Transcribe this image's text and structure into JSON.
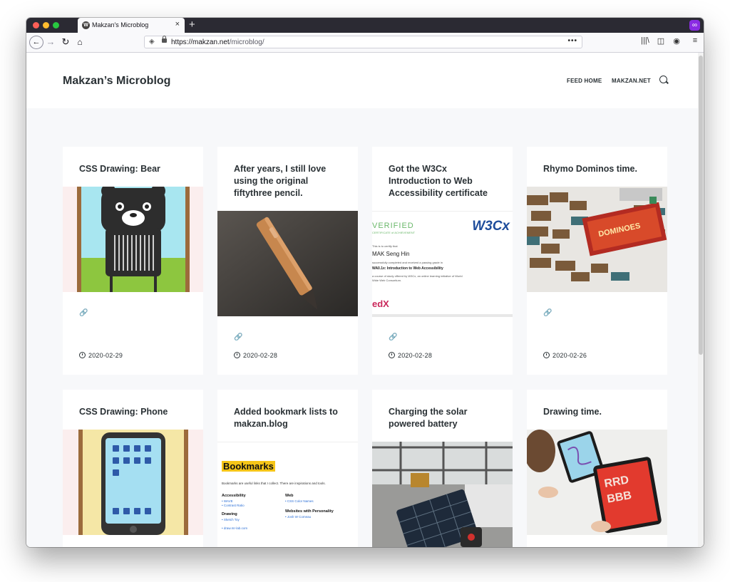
{
  "browser": {
    "tab_title": "Makzan's Microblog",
    "tab_close": "×",
    "new_tab": "+",
    "url_host": "https://makzan.net",
    "url_path": "/microblog/",
    "url_more": "•••",
    "back": "←",
    "forward": "→",
    "reload": "↻",
    "home": "⌂",
    "library": "|||\\",
    "sidebar": "◫",
    "account": "◉",
    "menu": "≡",
    "extension": "∞",
    "shield": "◈"
  },
  "site": {
    "title": "Makzan’s Microblog",
    "nav": [
      "FEED HOME",
      "MAKZAN.NET"
    ]
  },
  "cards": [
    {
      "title": "CSS Drawing: Bear",
      "date": "2020-02-29",
      "link_icon": "🔗"
    },
    {
      "title": "After years, I still love using the original fiftythree pencil.",
      "date": "2020-02-28",
      "link_icon": "🔗"
    },
    {
      "title": "Got the W3Cx Introduction to Web Accessibility certificate",
      "date": "2020-02-28",
      "link_icon": "🔗"
    },
    {
      "title": "Rhymo Dominos time.",
      "date": "2020-02-26",
      "link_icon": "🔗"
    },
    {
      "title": "CSS Drawing: Phone"
    },
    {
      "title": "Added bookmark lists to makzan.blog"
    },
    {
      "title": "Charging the solar powered battery"
    },
    {
      "title": "Drawing time."
    }
  ],
  "cert": {
    "verified": "VERIFIED",
    "sub": "CERTIFICATE of ACHIEVEMENT",
    "logo": "W3Cx",
    "intro": "This is to certify that",
    "name": "MAK Seng Hin",
    "passed": "successfully completed and received a passing grade in",
    "course": "WA0.1x: Introduction to Web Accessibility",
    "desc": "a course of study offered by W3Cx, an online learning initiative of World Wide Web Consortium.",
    "edx": "edX"
  },
  "bookmarks": {
    "heading": "Bookmarks",
    "intro": "Bookmarks are useful links that I collect. There are inspirations and tools.",
    "col1": [
      {
        "h": "Accessibility",
        "items": [
          "• WAVE",
          "• Contrast Ratio"
        ]
      },
      {
        "h": "Drawing",
        "items": [
          "• Sketch Toy",
          "• draw.mr-lab.com"
        ]
      }
    ],
    "col2": [
      {
        "h": "Web",
        "items": [
          "• CSS Color Names"
        ]
      },
      {
        "h": "Websites with Personality",
        "items": [
          "• Josh W Comeau"
        ]
      }
    ]
  },
  "dominos": {
    "label": "DOMINOES"
  },
  "drawing": {
    "text1": "RRD",
    "text2": "BBB"
  }
}
